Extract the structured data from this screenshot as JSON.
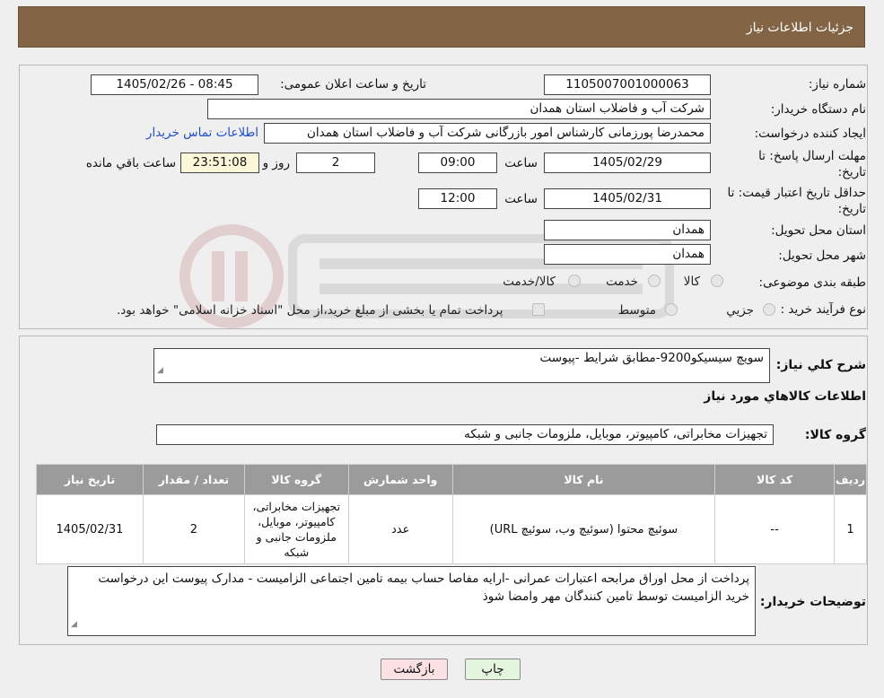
{
  "page": {
    "title": "جزئیات اطلاعات نیاز"
  },
  "fields": {
    "need_number_label": "شماره نیاز:",
    "need_number": "1105007001000063",
    "announce_label": "تاریخ و ساعت اعلان عمومی:",
    "announce_value": "1405/02/26 - 08:45",
    "buyer_org_label": "نام دستگاه خریدار:",
    "buyer_org": "شرکت آب و فاضلاب استان همدان",
    "creator_label": "ایجاد کننده درخواست:",
    "creator": "محمدرضا پورزمانی کارشناس امور بازرگانی شرکت آب و فاضلاب استان همدان",
    "contact_link": "اطلاعات تماس خریدار",
    "deadline_label_1": "مهلت ارسال پاسخ: تا",
    "deadline_label_2": "تاریخ:",
    "deadline_date": "1405/02/29",
    "time_label": "ساعت",
    "deadline_time": "09:00",
    "days_value": "2",
    "days_label": "روز و",
    "remaining_time": "23:51:08",
    "remaining_label": "ساعت باقي مانده",
    "validity_label_1": "حداقل تاریخ اعتبار قیمت: تا",
    "validity_label_2": "تاریخ:",
    "validity_date": "1405/02/31",
    "validity_time": "12:00",
    "province_label": "استان محل تحویل:",
    "province": "همدان",
    "city_label": "شهر محل تحویل:",
    "city": "همدان",
    "category_label": "طبقه بندی موضوعی:",
    "category_options": [
      "کالا",
      "خدمت",
      "کالا/خدمت"
    ],
    "process_label": "نوع فرآیند خرید :",
    "process_options": [
      "جزیي",
      "متوسط"
    ],
    "process_note": "پرداخت تمام یا بخشی از مبلغ خرید،از محل \"اسناد خزانه اسلامی\" خواهد بود."
  },
  "description": {
    "label": "شرح کلي نياز:",
    "value": "سویچ سیسیکو9200-مطابق شرایط -پیوست"
  },
  "goods_info": {
    "title": "اطلاعات کالاهاي مورد نياز",
    "group_label": "گروه کالا:",
    "group_value": "تجهیزات مخابراتی، کامپیوتر، موبایل، ملزومات جانبی و شبکه"
  },
  "table": {
    "headers": [
      "رديف",
      "کد کالا",
      "نام کالا",
      "واحد شمارش",
      "گروه کالا",
      "تعداد / مقدار",
      "تاريخ نياز"
    ],
    "rows": [
      [
        "1",
        "--",
        "سوئیچ محتوا (سوئیچ وب، سوئیچ URL)",
        "عدد",
        "تجهیزات مخابراتی، کامپیوتر، موبایل، ملزومات جانبی و شبکه",
        "2",
        "1405/02/31"
      ]
    ]
  },
  "buyer_notes": {
    "label": "توضيحات خريدار:",
    "value": "پرداخت از محل اوراق مرابحه اعتبارات عمرانی -ارایه مفاصا حساب بیمه تامین اجتماعی الزامیست - مدارک پیوست این درخواست خرید الزامیست توسط تامین کنندگان مهر وامضا شوذ"
  },
  "buttons": {
    "print": "چاپ",
    "back": "بازگشت"
  },
  "colors": {
    "header_bg": "#836545",
    "table_header_bg": "#9b9b9b",
    "link": "#1f4fd0",
    "back_button_bg": "#fbe0e4",
    "print_button_bg": "#e4f5dd"
  }
}
